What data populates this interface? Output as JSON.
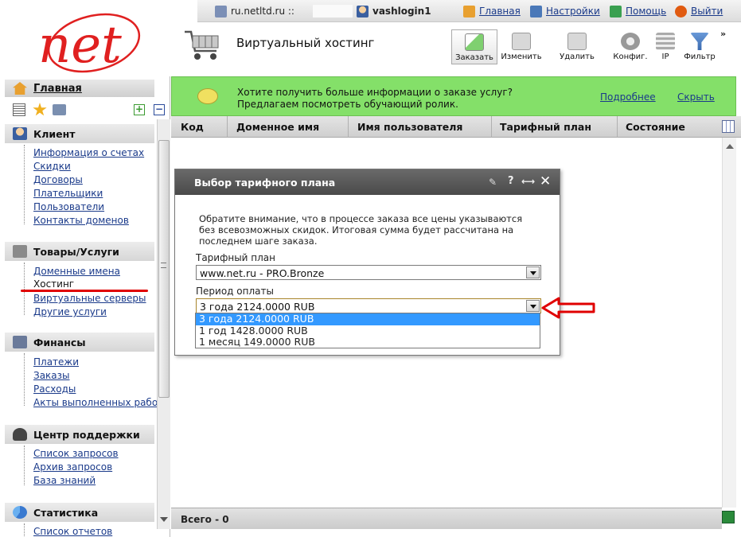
{
  "topbar": {
    "domain": "ru.netltd.ru ::",
    "user": "vashlogin1",
    "home": "Главная",
    "settings": "Настройки",
    "help": "Помощь",
    "logout": "Выйти"
  },
  "logo_text": "net",
  "header": {
    "title": "Виртуальный хостинг",
    "toolbar": {
      "order": "Заказать",
      "edit": "Изменить",
      "delete": "Удалить",
      "config": "Конфиг.",
      "ip": "IP",
      "filter": "Фильтр",
      "more": "»"
    }
  },
  "sidebar": {
    "home": "Главная",
    "sections": [
      {
        "title": "Клиент",
        "items": [
          "Информация о счетах",
          "Скидки",
          "Договоры",
          "Плательщики",
          "Пользователи",
          "Контакты доменов"
        ]
      },
      {
        "title": "Товары/Услуги",
        "items": [
          "Доменные имена",
          "Хостинг",
          "Виртуальные серверы",
          "Другие услуги"
        ]
      },
      {
        "title": "Финансы",
        "items": [
          "Платежи",
          "Заказы",
          "Расходы",
          "Акты выполненных работ"
        ]
      },
      {
        "title": "Центр поддержки",
        "items": [
          "Список запросов",
          "Архив запросов",
          "База знаний"
        ]
      },
      {
        "title": "Статистика",
        "items": [
          "Список отчетов"
        ]
      }
    ]
  },
  "notice": {
    "text": "Хотите получить больше информации о заказе услуг? Предлагаем посмотреть обучающий ролик.",
    "more": "Подробнее",
    "hide": "Скрыть"
  },
  "table": {
    "columns": [
      "Код",
      "Доменное имя",
      "Имя пользователя",
      "Тарифный план",
      "Состояние"
    ],
    "total": "Всего - 0"
  },
  "dialog": {
    "title": "Выбор тарифного плана",
    "note": "Обратите внимание, что в процессе заказа все цены указываются без всевозможных скидок. Итоговая сумма будет рассчитана на последнем шаге заказа.",
    "plan_label": "Тарифный план",
    "plan_value": "www.net.ru - PRO.Bronze",
    "period_label": "Период оплаты",
    "period_value": "3 года 2124.0000 RUB",
    "options": [
      "3 года 2124.0000 RUB",
      "1 год 1428.0000 RUB",
      "1 месяц 149.0000 RUB"
    ]
  },
  "colors": {
    "notice_bg": "#84e069",
    "logo_red": "#e02020",
    "highlight": "#3399ff",
    "annotation_red": "#e00000"
  }
}
